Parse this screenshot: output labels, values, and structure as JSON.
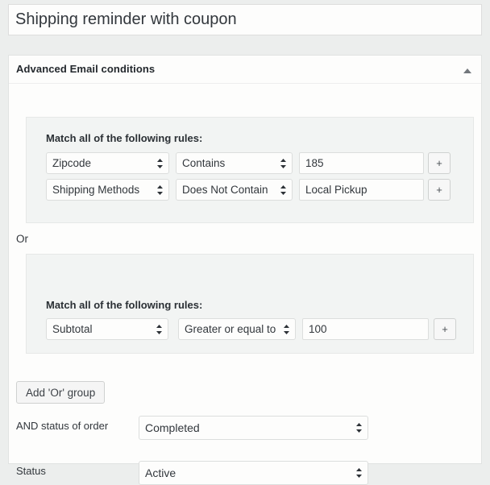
{
  "post_title": {
    "value": "Shipping reminder with coupon",
    "placeholder": "Enter title here"
  },
  "panel": {
    "title": "Advanced Email conditions",
    "toggle_icon": "caret-up-icon"
  },
  "or_separator_label": "Or",
  "groups": [
    {
      "match_label": "Match all of the following rules:",
      "rules": [
        {
          "field": "Zipcode",
          "operator": "Contains",
          "value": "185",
          "value_placeholder": "",
          "add_label": "+"
        },
        {
          "field": "Shipping Methods",
          "operator": "Does Not Contain",
          "value": "Local Pickup",
          "value_placeholder": "",
          "add_label": "+"
        }
      ]
    },
    {
      "match_label": "Match all of the following rules:",
      "rules": [
        {
          "field": "Subtotal",
          "operator": "Greater or equal to",
          "value": "100",
          "value_placeholder": "",
          "add_label": "+"
        }
      ]
    }
  ],
  "add_or_group_button": "Add 'Or' group",
  "footer_fields": [
    {
      "label": "AND status of order",
      "value": "Completed"
    },
    {
      "label": "Status",
      "value": "Active"
    }
  ],
  "colors": {
    "page_background": "#eceeed",
    "panel_background": "#fdfdfc",
    "group_background": "#f2f4f3",
    "border": "#dcdedd",
    "text": "#32373c"
  }
}
